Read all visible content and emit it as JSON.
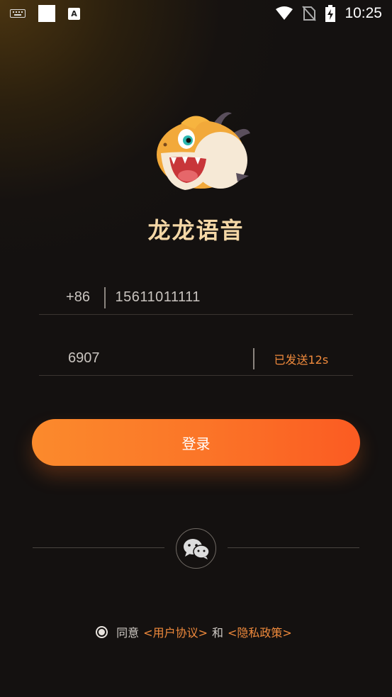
{
  "status_bar": {
    "time": "10:25",
    "icons": [
      "keyboard-icon",
      "notification-square-icon",
      "a-icon",
      "wifi-icon",
      "no-sim-icon",
      "battery-charging-icon"
    ],
    "a_icon_text": "A"
  },
  "app": {
    "name": "龙龙语音",
    "logo": "dragon-mascot-logo"
  },
  "form": {
    "country_code": "+86",
    "phone_value": "15611011111",
    "code_value": "6907",
    "send_code_status": "已发送12s",
    "login_label": "登录"
  },
  "third_party": {
    "icon": "wechat-icon"
  },
  "agreement": {
    "prefix": "同意",
    "user_agreement": "<用户协议>",
    "conjunction": "和",
    "privacy_policy": "<隐私政策>"
  },
  "colors": {
    "accent": "#f08a3c",
    "button_start": "#fb8a2c",
    "button_end": "#fb5b22",
    "brand_text": "#f4d7a6",
    "background": "#141110"
  }
}
